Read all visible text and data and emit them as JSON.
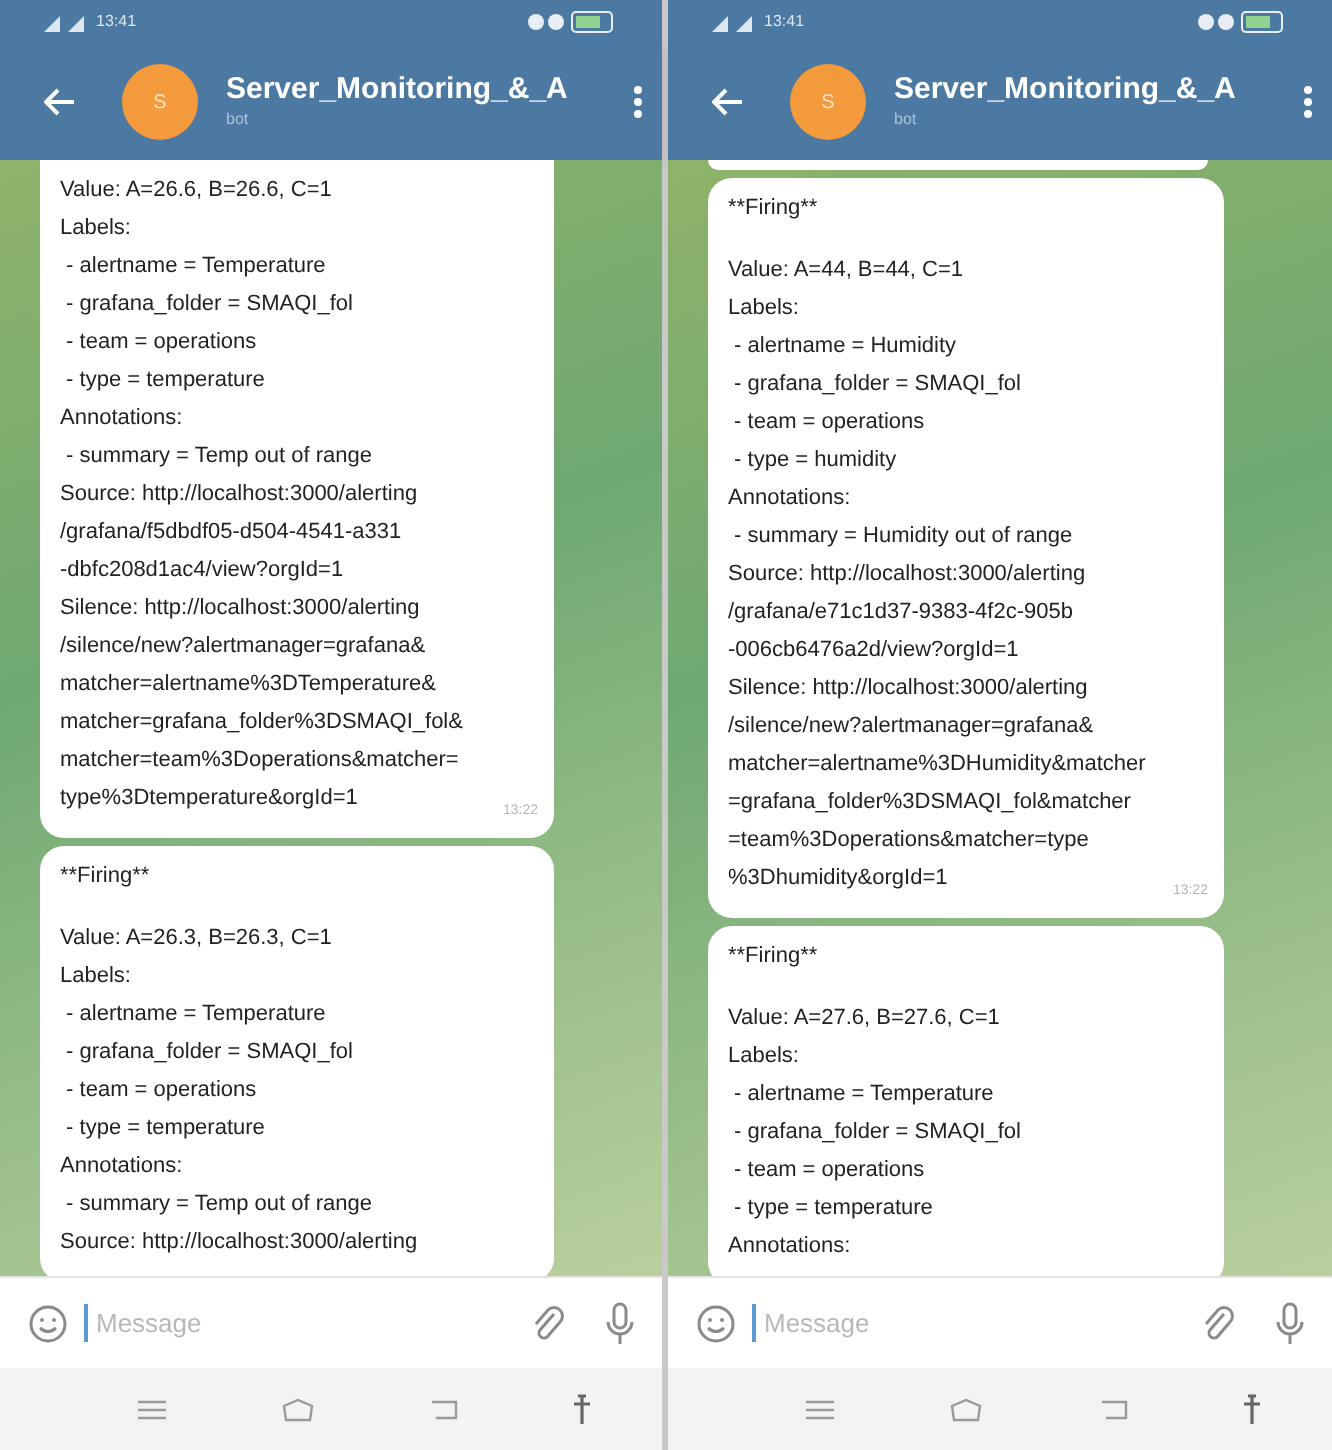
{
  "phones": [
    {
      "status_bar": {
        "time": "13:41"
      },
      "header": {
        "title": "Server_Monitoring_&_A",
        "subtitle": "bot",
        "avatar_letter": "S"
      },
      "messages": [
        {
          "kind": "alert",
          "lines": [
            "Value: A=26.6, B=26.6, C=1",
            "Labels:",
            " - alertname = Temperature",
            " - grafana_folder = SMAQI_fol",
            " - team = operations",
            " - type = temperature",
            "Annotations:",
            " - summary = Temp out of range",
            "Source: http://localhost:3000/alerting",
            "/grafana/f5dbdf05-d504-4541-a331",
            "-dbfc208d1ac4/view?orgId=1",
            "Silence: http://localhost:3000/alerting",
            "/silence/new?alertmanager=grafana&",
            "matcher=alertname%3DTemperature&",
            "matcher=grafana_folder%3DSMAQI_fol&",
            "matcher=team%3Doperations&matcher=",
            "type%3Dtemperature&orgId=1"
          ],
          "time": "13:22"
        },
        {
          "kind": "alert",
          "header": "**Firing**",
          "lines": [
            "Value: A=26.3, B=26.3, C=1",
            "Labels:",
            " - alertname = Temperature",
            " - grafana_folder = SMAQI_fol",
            " - team = operations",
            " - type = temperature",
            "Annotations:",
            " - summary = Temp out of range",
            "Source: http://localhost:3000/alerting"
          ]
        }
      ],
      "input": {
        "placeholder": "Message"
      }
    },
    {
      "status_bar": {
        "time": "13:41"
      },
      "header": {
        "title": "Server_Monitoring_&_A",
        "subtitle": "bot",
        "avatar_letter": "S"
      },
      "messages": [
        {
          "kind": "fragment"
        },
        {
          "kind": "alert",
          "header": "**Firing**",
          "lines": [
            "Value: A=44, B=44, C=1",
            "Labels:",
            " - alertname = Humidity",
            " - grafana_folder = SMAQI_fol",
            " - team = operations",
            " - type = humidity",
            "Annotations:",
            " - summary = Humidity out of range",
            "Source: http://localhost:3000/alerting",
            "/grafana/e71c1d37-9383-4f2c-905b",
            "-006cb6476a2d/view?orgId=1",
            "Silence: http://localhost:3000/alerting",
            "/silence/new?alertmanager=grafana&",
            "matcher=alertname%3DHumidity&matcher",
            "=grafana_folder%3DSMAQI_fol&matcher",
            "=team%3Doperations&matcher=type",
            "%3Dhumidity&orgId=1"
          ],
          "time": "13:22"
        },
        {
          "kind": "alert",
          "header": "**Firing**",
          "lines": [
            "Value: A=27.6, B=27.6, C=1",
            "Labels:",
            " - alertname = Temperature",
            " - grafana_folder = SMAQI_fol",
            " - team = operations",
            " - type = temperature",
            "Annotations:"
          ]
        }
      ],
      "input": {
        "placeholder": "Message"
      }
    }
  ]
}
